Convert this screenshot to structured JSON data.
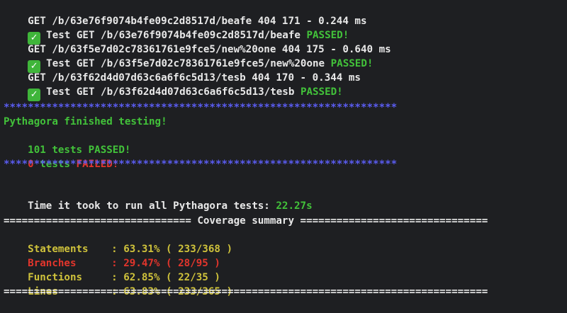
{
  "log": [
    {
      "text": "GET /b/63e76f9074b4fe09c2d8517d/beafe 404 171 - 0.244 ms"
    },
    {
      "test": "Test GET /b/63e76f9074b4fe09c2d8517d/beafe",
      "status": "PASSED!"
    },
    {
      "text": "GET /b/63f5e7d02c78361761e9fce5/new%20one 404 175 - 0.640 ms"
    },
    {
      "test": "Test GET /b/63f5e7d02c78361761e9fce5/new%20one",
      "status": "PASSED!"
    },
    {
      "text": "GET /b/63f62d4d07d63c6a6f6c5d13/tesb 404 170 - 0.344 ms"
    },
    {
      "test": "Test GET /b/63f62d4d07d63c6a6f6c5d13/tesb",
      "status": "PASSED!"
    }
  ],
  "summary": {
    "separator": "*****************************************************************",
    "finished": "Pythagora finished testing!",
    "passed_count": "101",
    "passed_text": "tests",
    "passed_label": "PASSED!",
    "failed_count": "0",
    "failed_text": "tests",
    "failed_label": "FAILED!"
  },
  "timing": {
    "label": "Time it took to run all Pythagora tests:",
    "value": "22.27s"
  },
  "coverage": {
    "header": "=============================== Coverage summary ===============================",
    "rows": [
      {
        "name": "Statements",
        "value": ": 63.31% ( 233/368 )",
        "color": "#cfc23b"
      },
      {
        "name": "Branches",
        "value": ": 29.47% ( 28/95 )",
        "color": "#e2352c"
      },
      {
        "name": "Functions",
        "value": ": 62.85% ( 22/35 )",
        "color": "#cfc23b"
      },
      {
        "name": "Lines",
        "value": ": 63.83% ( 233/365 )",
        "color": "#cfc23b"
      }
    ],
    "footer": "================================================================================"
  },
  "colors": {
    "background": "#1e1f22",
    "green": "#42c23a",
    "red": "#e2352c",
    "blue": "#5a5cf0",
    "yellow": "#cfc23b"
  }
}
